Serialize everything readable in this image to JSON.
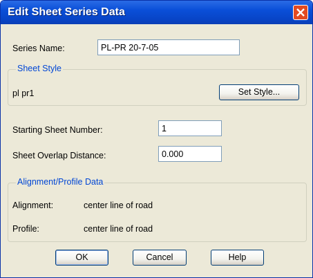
{
  "window": {
    "title": "Edit Sheet Series Data"
  },
  "series_name": {
    "label": "Series Name:",
    "value": "PL-PR 20-7-05"
  },
  "sheet_style": {
    "group_title": "Sheet Style",
    "style_name": "pl pr1",
    "set_style_label": "Set Style..."
  },
  "starting_sheet_number": {
    "label": "Starting Sheet Number:",
    "value": "1"
  },
  "sheet_overlap_distance": {
    "label": "Sheet Overlap Distance:",
    "value": "0.000"
  },
  "alignment_profile": {
    "group_title": "Alignment/Profile Data",
    "alignment_label": "Alignment:",
    "alignment_value": "center line of road",
    "profile_label": "Profile:",
    "profile_value": "center line of road"
  },
  "buttons": {
    "ok": "OK",
    "cancel": "Cancel",
    "help": "Help"
  },
  "colors": {
    "titlebar": "#0A4FD8",
    "close": "#E24A22",
    "group_title": "#0046D5",
    "dialog_bg": "#ECE9D8"
  }
}
